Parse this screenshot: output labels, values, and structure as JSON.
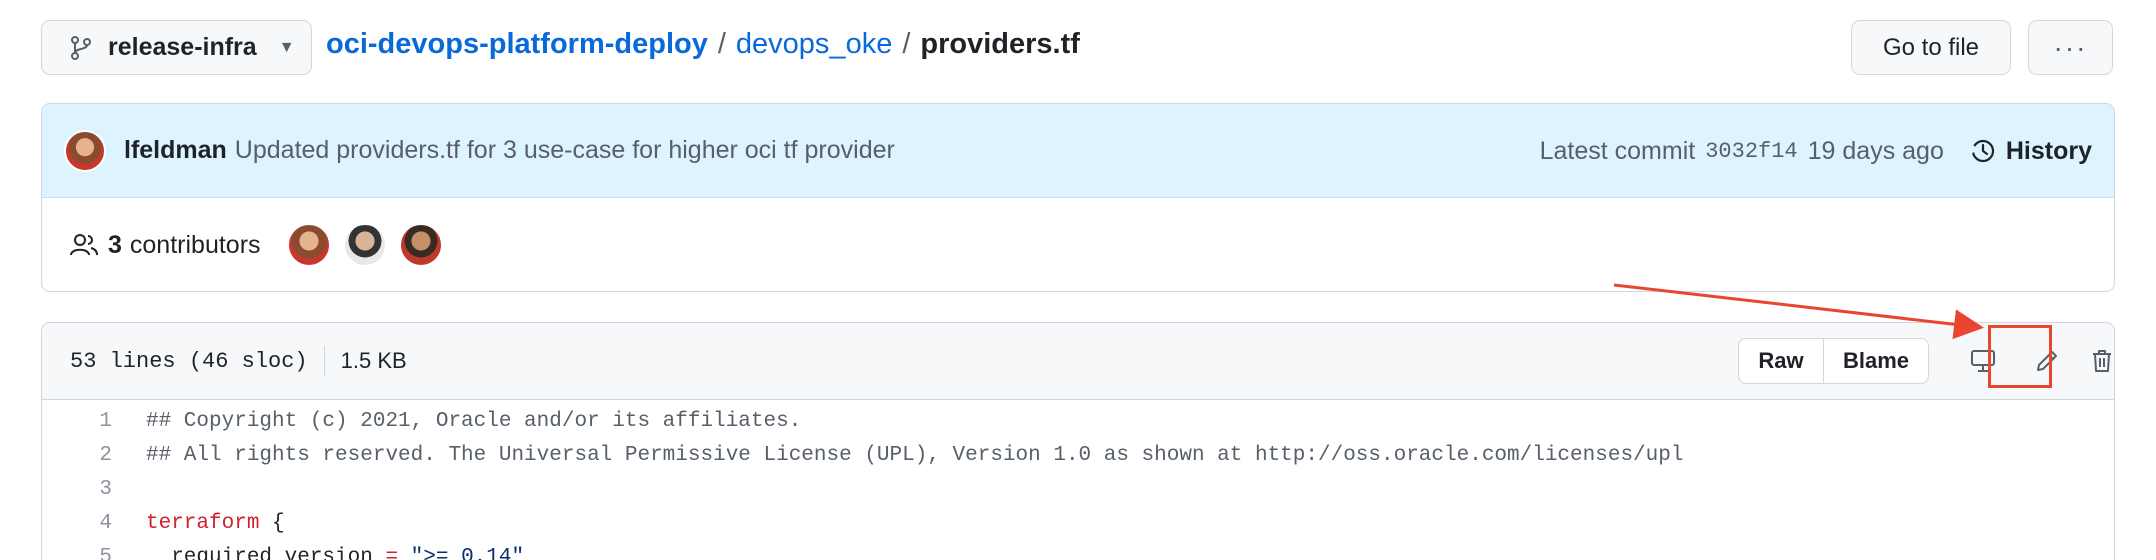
{
  "header": {
    "branch": "release-infra",
    "repo": "oci-devops-platform-deploy",
    "dir": "devops_oke",
    "file": "providers.tf",
    "goto_label": "Go to file",
    "more_label": "···"
  },
  "commit": {
    "author": "lfeldman",
    "message": "Updated providers.tf for 3 use-case for higher oci tf provider",
    "latest_label": "Latest commit",
    "hash": "3032f14",
    "age": "19 days ago",
    "history_label": "History"
  },
  "contributors": {
    "count": "3",
    "label": "contributors"
  },
  "file_info": {
    "lines": "53 lines (46 sloc)",
    "size": "1.5 KB",
    "raw_label": "Raw",
    "blame_label": "Blame"
  },
  "code": [
    {
      "n": "1",
      "text": "## Copyright (c) 2021, Oracle and/or its affiliates."
    },
    {
      "n": "2",
      "text": "## All rights reserved. The Universal Permissive License (UPL), Version 1.0 as shown at http://oss.oracle.com/licenses/upl"
    },
    {
      "n": "3",
      "text": ""
    },
    {
      "n": "4",
      "kw": "terraform",
      "rest": " {"
    },
    {
      "n": "5",
      "key": "  required_version",
      "eq": " = ",
      "str": "\">= 0.14\""
    }
  ],
  "colors": {
    "accent_link": "#0969da",
    "annotation_red": "#e8462f",
    "commit_bg": "#ddf4ff"
  }
}
